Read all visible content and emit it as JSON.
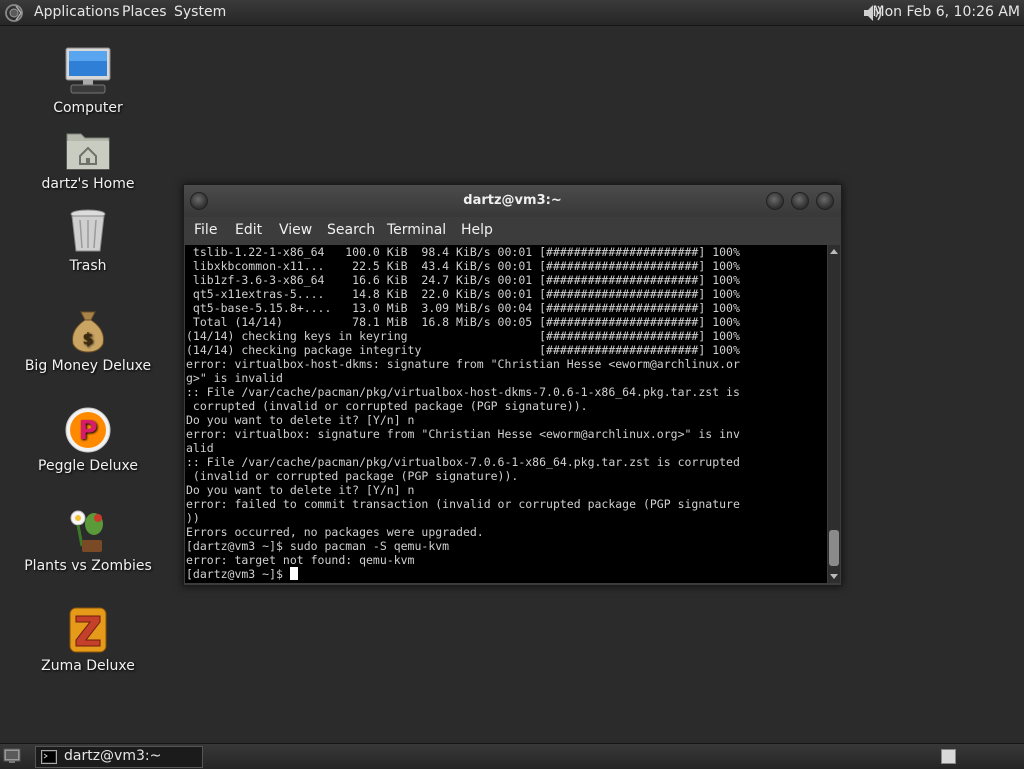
{
  "top_panel": {
    "menus": [
      "Applications",
      "Places",
      "System"
    ],
    "clock": "Mon Feb  6, 10:26 AM"
  },
  "desktop": {
    "icons": [
      {
        "label": "Computer",
        "icon": "computer-icon"
      },
      {
        "label": "dartz's Home",
        "icon": "home-folder-icon"
      },
      {
        "label": "Trash",
        "icon": "trash-icon"
      },
      {
        "label": "Big Money Deluxe",
        "icon": "money-bag-icon"
      },
      {
        "label": "Peggle Deluxe",
        "icon": "peggle-icon"
      },
      {
        "label": "Plants vs Zombies",
        "icon": "plants-icon"
      },
      {
        "label": "Zuma Deluxe",
        "icon": "zuma-icon"
      }
    ]
  },
  "terminal": {
    "title": "dartz@vm3:~",
    "menu": [
      "File",
      "Edit",
      "View",
      "Search",
      "Terminal",
      "Help"
    ],
    "lines": [
      " tslib-1.22-1-x86_64   100.0 KiB  98.4 KiB/s 00:01 [######################] 100%",
      " libxkbcommon-x11...    22.5 KiB  43.4 KiB/s 00:01 [######################] 100%",
      " lib1zf-3.6-3-x86_64    16.6 KiB  24.7 KiB/s 00:01 [######################] 100%",
      " qt5-x11extras-5....    14.8 KiB  22.0 KiB/s 00:01 [######################] 100%",
      " qt5-base-5.15.8+....   13.0 MiB  3.09 MiB/s 00:04 [######################] 100%",
      " Total (14/14)          78.1 MiB  16.8 MiB/s 00:05 [######################] 100%",
      "(14/14) checking keys in keyring                   [######################] 100%",
      "(14/14) checking package integrity                 [######################] 100%",
      "error: virtualbox-host-dkms: signature from \"Christian Hesse <eworm@archlinux.or",
      "g>\" is invalid",
      ":: File /var/cache/pacman/pkg/virtualbox-host-dkms-7.0.6-1-x86_64.pkg.tar.zst is",
      " corrupted (invalid or corrupted package (PGP signature)).",
      "Do you want to delete it? [Y/n] n",
      "error: virtualbox: signature from \"Christian Hesse <eworm@archlinux.org>\" is inv",
      "alid",
      ":: File /var/cache/pacman/pkg/virtualbox-7.0.6-1-x86_64.pkg.tar.zst is corrupted",
      " (invalid or corrupted package (PGP signature)).",
      "Do you want to delete it? [Y/n] n",
      "error: failed to commit transaction (invalid or corrupted package (PGP signature",
      "))",
      "Errors occurred, no packages were upgraded.",
      "[dartz@vm3 ~]$ sudo pacman -S qemu-kvm",
      "error: target not found: qemu-kvm"
    ],
    "prompt": "[dartz@vm3 ~]$ "
  },
  "bottom_panel": {
    "task_label": "dartz@vm3:~"
  }
}
